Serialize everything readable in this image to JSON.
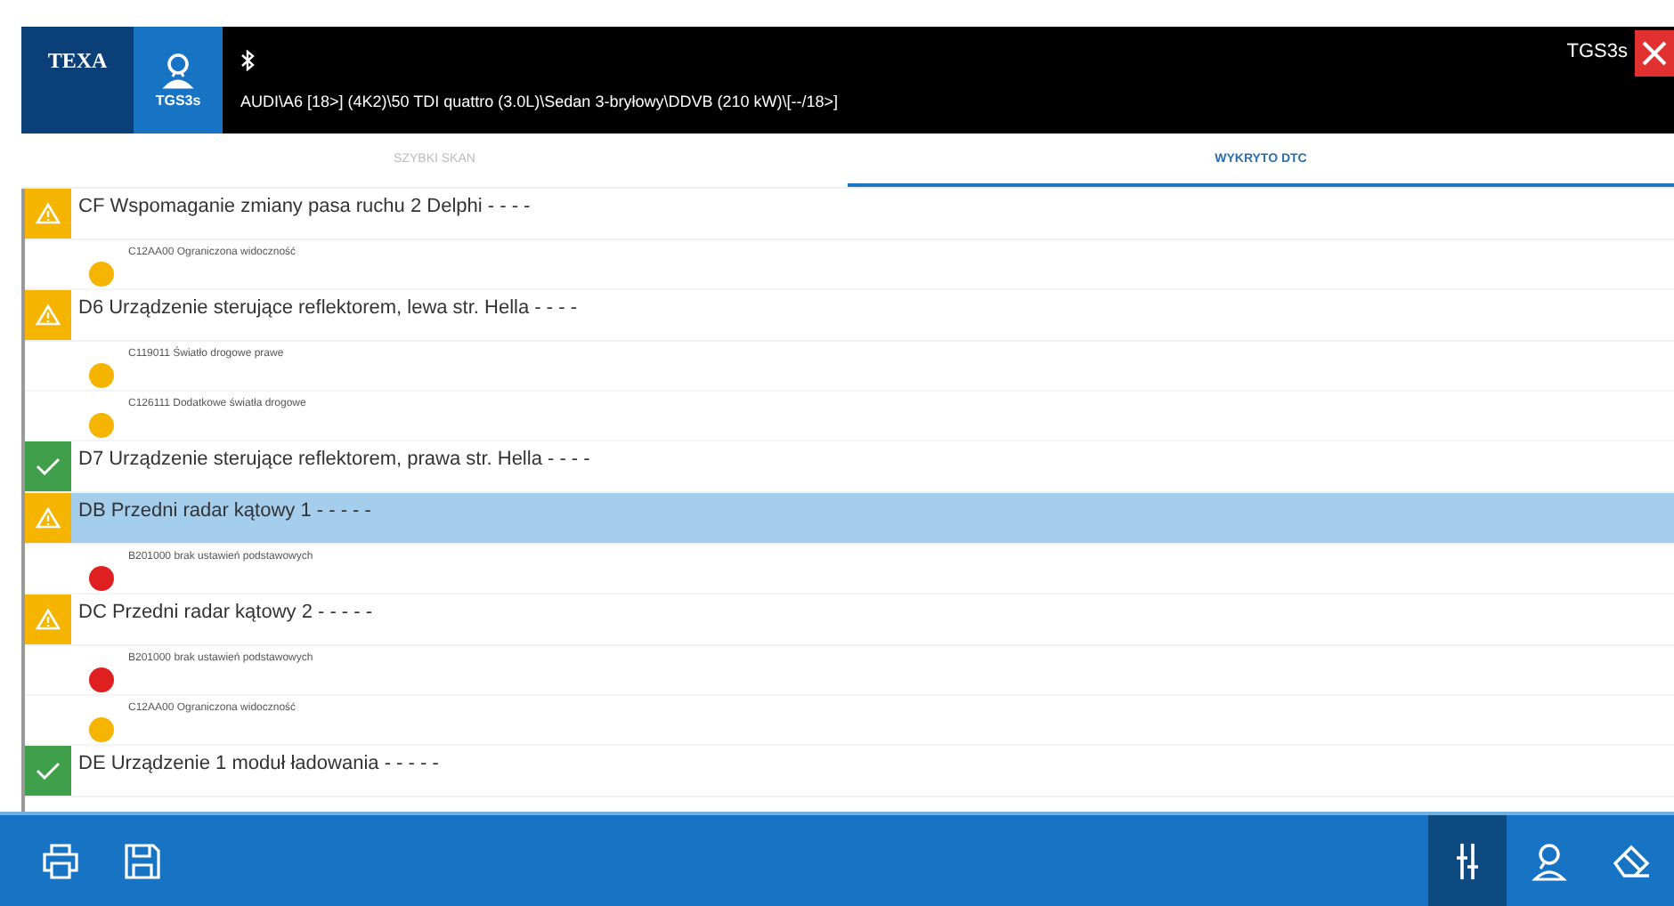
{
  "header": {
    "logo": "TEXA",
    "device_button": {
      "label": "TGS3s"
    },
    "vehicle": "AUDI\\A6 [18>] (4K2)\\50 TDI quattro (3.0L)\\Sedan 3-bryłowy\\DDVB (210 kW)\\[--/18>]",
    "device_name": "TGS3s"
  },
  "tabs": [
    {
      "label": "SZYBKI SKAN",
      "selected": false
    },
    {
      "label": "WYKRYTO DTC",
      "selected": true
    }
  ],
  "modules": [
    {
      "kind": "warning",
      "title": "CF Wspomaganie zmiany pasa ruchu 2 Delphi - - - -",
      "selected": false,
      "dtcs": [
        {
          "text": "C12AA00 Ograniczona widoczność",
          "color": "#f5b400"
        }
      ]
    },
    {
      "kind": "warning",
      "title": "D6 Urządzenie sterujące reflektorem, lewa str. Hella - - - -",
      "selected": false,
      "dtcs": [
        {
          "text": "C119011 Światło drogowe prawe",
          "color": "#f5b400"
        },
        {
          "text": "C126111 Dodatkowe światła drogowe",
          "color": "#f5b400"
        }
      ]
    },
    {
      "kind": "ok",
      "title": "D7 Urządzenie sterujące reflektorem, prawa str. Hella - - - -",
      "selected": false
    },
    {
      "kind": "warning",
      "title": "DB Przedni radar kątowy 1 - - - - -",
      "selected": true,
      "dtcs": [
        {
          "text": "B201000 brak ustawień podstawowych",
          "color": "#e02020"
        }
      ]
    },
    {
      "kind": "warning",
      "title": "DC Przedni radar kątowy 2 - - - - -",
      "selected": false,
      "dtcs": [
        {
          "text": "B201000 brak ustawień podstawowych",
          "color": "#e02020"
        },
        {
          "text": "C12AA00 Ograniczona widoczność",
          "color": "#f5b400"
        }
      ]
    },
    {
      "kind": "ok",
      "title": "DE Urządzenie 1 moduł ładowania - - - - -",
      "selected": false
    }
  ],
  "toolbar": {
    "left": [
      {
        "kind": "print"
      },
      {
        "kind": "save"
      }
    ],
    "right": [
      {
        "kind": "filter",
        "selected": true
      },
      {
        "kind": "scan",
        "selected": false
      },
      {
        "kind": "erase",
        "selected": false
      }
    ]
  }
}
